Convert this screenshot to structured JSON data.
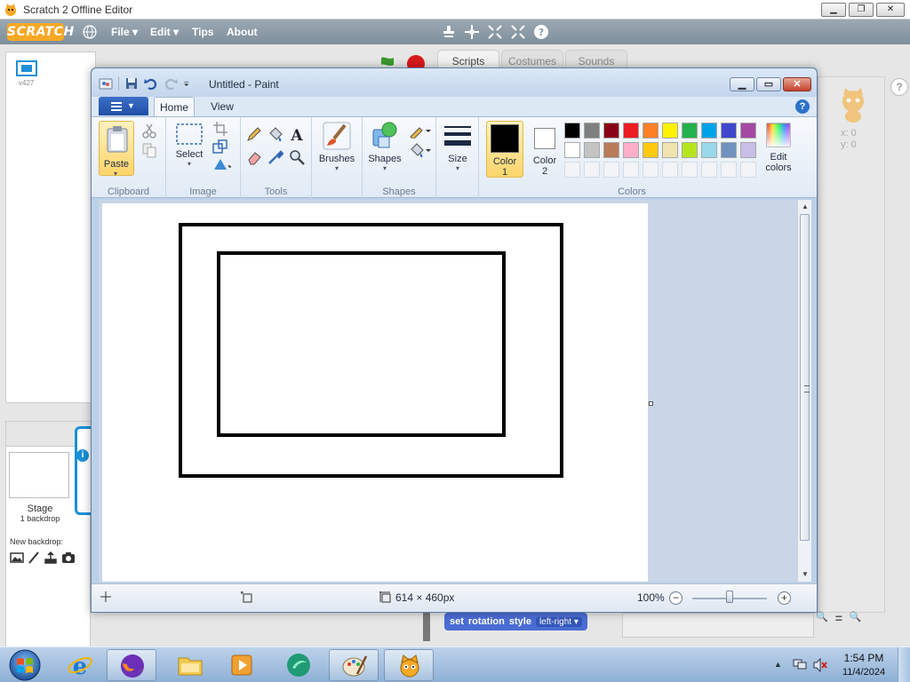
{
  "scratch": {
    "window_title": "Scratch 2 Offline Editor",
    "logo": "SCRATCH",
    "menus": [
      "File ▾",
      "Edit ▾",
      "Tips",
      "About"
    ],
    "version": "v427",
    "tabs": [
      "Scripts",
      "Costumes",
      "Sounds"
    ],
    "sprite_panel_letter": "S",
    "stage_label": "Stage",
    "stage_backdrops": "1 backdrop",
    "new_backdrop": "New backdrop:",
    "info_badge": "i",
    "coord_x": "x: 0",
    "coord_y": "y: 0",
    "help": "?",
    "block": {
      "set": "set",
      "rotation": "rotation",
      "style": "style",
      "option": "left-right ▾"
    },
    "zoom_tools": [
      "🔍",
      "=",
      "🔍"
    ]
  },
  "paint": {
    "window_title": "Untitled - Paint",
    "tabs": {
      "home": "Home",
      "view": "View"
    },
    "help": "?",
    "groups": {
      "clipboard": "Clipboard",
      "image": "Image",
      "tools": "Tools",
      "shapes": "Shapes",
      "colors": "Colors"
    },
    "buttons": {
      "paste": "Paste",
      "select": "Select",
      "brushes": "Brushes",
      "shapes": "Shapes",
      "size": "Size",
      "color1_line1": "Color",
      "color1_line2": "1",
      "color2_line1": "Color",
      "color2_line2": "2",
      "edit_colors_line1": "Edit",
      "edit_colors_line2": "colors"
    },
    "colors": {
      "color1": "#000000",
      "color2": "#ffffff",
      "palette_row1": [
        "#000000",
        "#7f7f7f",
        "#880015",
        "#ed1c24",
        "#ff7f27",
        "#fff200",
        "#22b14c",
        "#00a2e8",
        "#3f48cc",
        "#a349a4"
      ],
      "palette_row2": [
        "#ffffff",
        "#c3c3c3",
        "#b97a57",
        "#ffaec9",
        "#ffc90e",
        "#efe4b0",
        "#b5e61d",
        "#99d9ea",
        "#7092be",
        "#c8bfe7"
      ]
    },
    "status": {
      "size": "614 × 460px",
      "zoom": "100%"
    }
  },
  "taskbar": {
    "time": "1:54 PM",
    "date": "11/4/2024"
  }
}
